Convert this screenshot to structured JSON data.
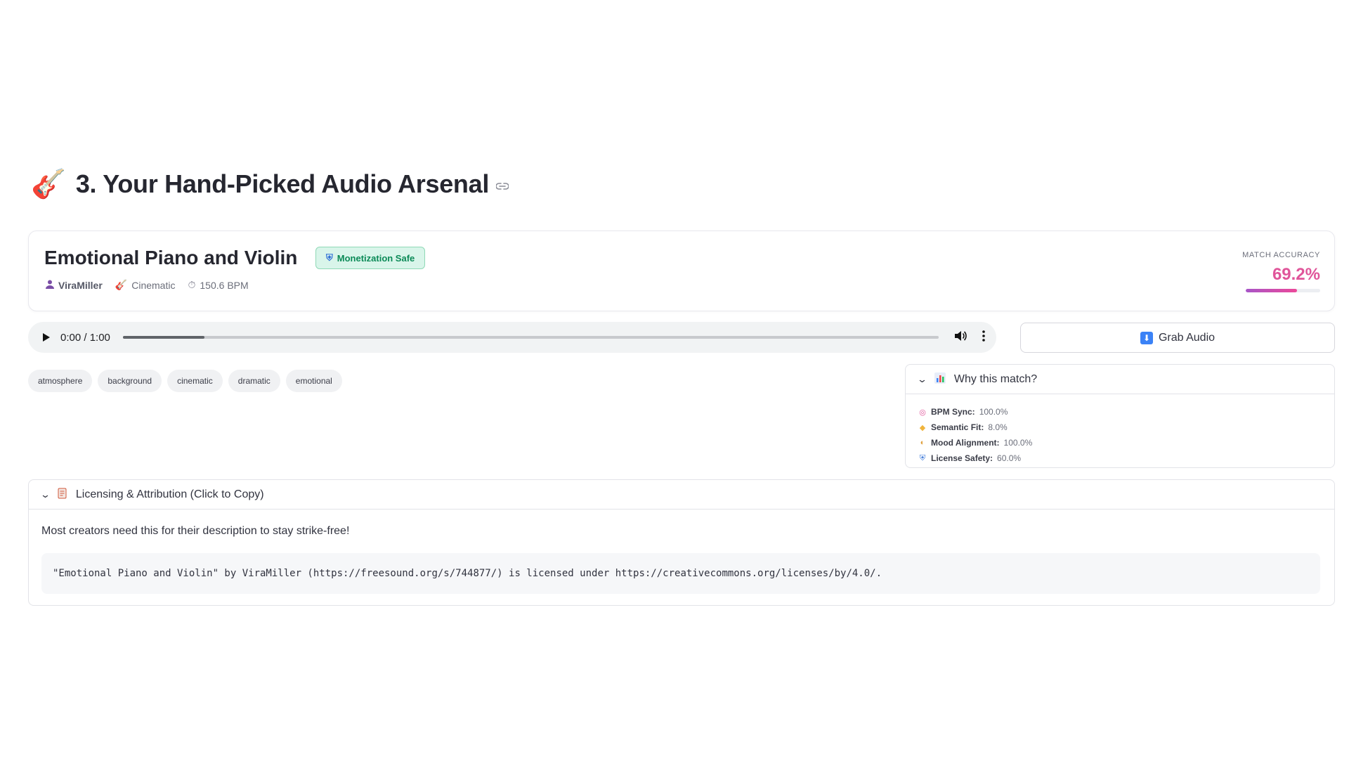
{
  "section": {
    "emoji": "🎸",
    "title": "3. Your Hand-Picked Audio Arsenal",
    "link_icon": "link-icon"
  },
  "track": {
    "title": "Emotional Piano and Violin",
    "badge": "Monetization Safe",
    "badge_icon": "shield-icon",
    "author": "ViraMiller",
    "genre": "Cinematic",
    "bpm": "150.6 BPM",
    "accuracy_label": "MATCH ACCURACY",
    "accuracy_value": "69.2%",
    "accuracy_fraction": 0.692
  },
  "player": {
    "time": "0:00 / 1:00",
    "progress_fraction": 0.1
  },
  "grab_button": {
    "label": "Grab Audio",
    "icon": "download-icon"
  },
  "tags": [
    "atmosphere",
    "background",
    "cinematic",
    "dramatic",
    "emotional"
  ],
  "why_match": {
    "title": "Why this match?",
    "rows": [
      {
        "label": "BPM Sync:",
        "value": "100.0%"
      },
      {
        "label": "Semantic Fit:",
        "value": "8.0%"
      },
      {
        "label": "Mood Alignment:",
        "value": "100.0%"
      },
      {
        "label": "License Safety:",
        "value": "60.0%"
      }
    ]
  },
  "licensing": {
    "title": "Licensing & Attribution (Click to Copy)",
    "note": "Most creators need this for their description to stay strike-free!",
    "attribution": "\"Emotional Piano and Violin\" by ViraMiller (https://freesound.org/s/744877/) is licensed under https://creativecommons.org/licenses/by/4.0/."
  },
  "colors": {
    "accuracy": "#e0559a",
    "badge_bg": "#d9f5ea",
    "badge_text": "#0b8a57"
  }
}
